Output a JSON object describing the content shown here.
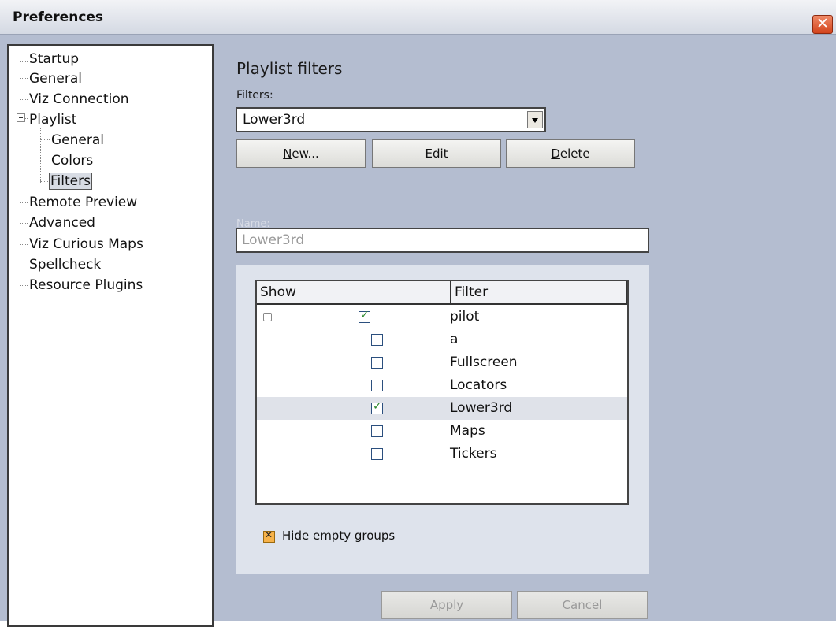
{
  "window": {
    "title": "Preferences"
  },
  "tree": {
    "items": [
      {
        "label": "Startup"
      },
      {
        "label": "General"
      },
      {
        "label": "Viz Connection"
      },
      {
        "label": "Playlist"
      },
      {
        "label": "General"
      },
      {
        "label": "Colors"
      },
      {
        "label": "Filters"
      },
      {
        "label": "Remote Preview"
      },
      {
        "label": "Advanced"
      },
      {
        "label": "Viz Curious Maps"
      },
      {
        "label": "Spellcheck"
      },
      {
        "label": "Resource Plugins"
      }
    ],
    "selected": "Filters"
  },
  "panel": {
    "heading": "Playlist filters",
    "filters_label": "Filters:",
    "filters_value": "Lower3rd",
    "buttons": {
      "new": {
        "mnemonic": "N",
        "rest": "ew..."
      },
      "edit": {
        "label": "Edit"
      },
      "delete": {
        "mnemonic": "D",
        "rest": "elete"
      }
    },
    "name_label": "Name:",
    "name_value": "Lower3rd"
  },
  "filter_list": {
    "columns": {
      "show": "Show",
      "filter": "Filter"
    },
    "rows": [
      {
        "label": "pilot",
        "checked": true
      },
      {
        "label": "a",
        "checked": false
      },
      {
        "label": "Fullscreen",
        "checked": false
      },
      {
        "label": "Locators",
        "checked": false
      },
      {
        "label": "Lower3rd",
        "checked": true,
        "selected": true
      },
      {
        "label": "Maps",
        "checked": false
      },
      {
        "label": "Tickers",
        "checked": false
      }
    ]
  },
  "options": {
    "hide_empty_groups": "Hide empty groups",
    "hide_empty_checked": true
  },
  "footer": {
    "apply": {
      "mnemonic": "A",
      "rest": "pply"
    },
    "cancel": {
      "before": "Ca",
      "mnemonic": "n",
      "after": "cel"
    }
  },
  "colors": {
    "background": "#b4bdd0",
    "tree_background": "#ffffff",
    "check_green": "#2f8a2f",
    "hide_checkbox": "#f6b24a"
  }
}
